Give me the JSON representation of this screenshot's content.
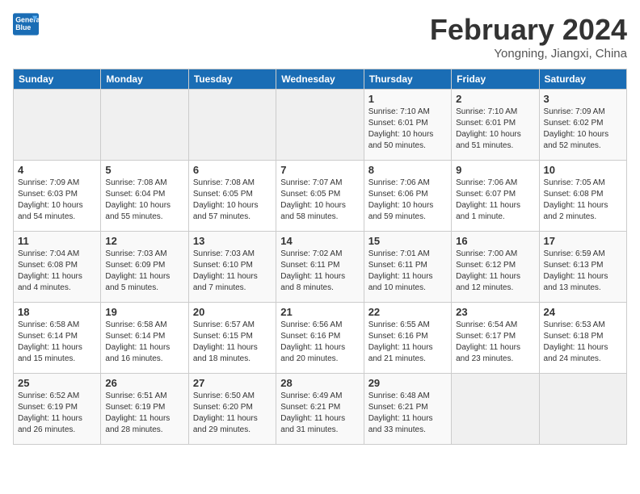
{
  "header": {
    "logo_line1": "General",
    "logo_line2": "Blue",
    "month": "February 2024",
    "location": "Yongning, Jiangxi, China"
  },
  "weekdays": [
    "Sunday",
    "Monday",
    "Tuesday",
    "Wednesday",
    "Thursday",
    "Friday",
    "Saturday"
  ],
  "weeks": [
    [
      {
        "day": "",
        "info": ""
      },
      {
        "day": "",
        "info": ""
      },
      {
        "day": "",
        "info": ""
      },
      {
        "day": "",
        "info": ""
      },
      {
        "day": "1",
        "info": "Sunrise: 7:10 AM\nSunset: 6:01 PM\nDaylight: 10 hours\nand 50 minutes."
      },
      {
        "day": "2",
        "info": "Sunrise: 7:10 AM\nSunset: 6:01 PM\nDaylight: 10 hours\nand 51 minutes."
      },
      {
        "day": "3",
        "info": "Sunrise: 7:09 AM\nSunset: 6:02 PM\nDaylight: 10 hours\nand 52 minutes."
      }
    ],
    [
      {
        "day": "4",
        "info": "Sunrise: 7:09 AM\nSunset: 6:03 PM\nDaylight: 10 hours\nand 54 minutes."
      },
      {
        "day": "5",
        "info": "Sunrise: 7:08 AM\nSunset: 6:04 PM\nDaylight: 10 hours\nand 55 minutes."
      },
      {
        "day": "6",
        "info": "Sunrise: 7:08 AM\nSunset: 6:05 PM\nDaylight: 10 hours\nand 57 minutes."
      },
      {
        "day": "7",
        "info": "Sunrise: 7:07 AM\nSunset: 6:05 PM\nDaylight: 10 hours\nand 58 minutes."
      },
      {
        "day": "8",
        "info": "Sunrise: 7:06 AM\nSunset: 6:06 PM\nDaylight: 10 hours\nand 59 minutes."
      },
      {
        "day": "9",
        "info": "Sunrise: 7:06 AM\nSunset: 6:07 PM\nDaylight: 11 hours\nand 1 minute."
      },
      {
        "day": "10",
        "info": "Sunrise: 7:05 AM\nSunset: 6:08 PM\nDaylight: 11 hours\nand 2 minutes."
      }
    ],
    [
      {
        "day": "11",
        "info": "Sunrise: 7:04 AM\nSunset: 6:08 PM\nDaylight: 11 hours\nand 4 minutes."
      },
      {
        "day": "12",
        "info": "Sunrise: 7:03 AM\nSunset: 6:09 PM\nDaylight: 11 hours\nand 5 minutes."
      },
      {
        "day": "13",
        "info": "Sunrise: 7:03 AM\nSunset: 6:10 PM\nDaylight: 11 hours\nand 7 minutes."
      },
      {
        "day": "14",
        "info": "Sunrise: 7:02 AM\nSunset: 6:11 PM\nDaylight: 11 hours\nand 8 minutes."
      },
      {
        "day": "15",
        "info": "Sunrise: 7:01 AM\nSunset: 6:11 PM\nDaylight: 11 hours\nand 10 minutes."
      },
      {
        "day": "16",
        "info": "Sunrise: 7:00 AM\nSunset: 6:12 PM\nDaylight: 11 hours\nand 12 minutes."
      },
      {
        "day": "17",
        "info": "Sunrise: 6:59 AM\nSunset: 6:13 PM\nDaylight: 11 hours\nand 13 minutes."
      }
    ],
    [
      {
        "day": "18",
        "info": "Sunrise: 6:58 AM\nSunset: 6:14 PM\nDaylight: 11 hours\nand 15 minutes."
      },
      {
        "day": "19",
        "info": "Sunrise: 6:58 AM\nSunset: 6:14 PM\nDaylight: 11 hours\nand 16 minutes."
      },
      {
        "day": "20",
        "info": "Sunrise: 6:57 AM\nSunset: 6:15 PM\nDaylight: 11 hours\nand 18 minutes."
      },
      {
        "day": "21",
        "info": "Sunrise: 6:56 AM\nSunset: 6:16 PM\nDaylight: 11 hours\nand 20 minutes."
      },
      {
        "day": "22",
        "info": "Sunrise: 6:55 AM\nSunset: 6:16 PM\nDaylight: 11 hours\nand 21 minutes."
      },
      {
        "day": "23",
        "info": "Sunrise: 6:54 AM\nSunset: 6:17 PM\nDaylight: 11 hours\nand 23 minutes."
      },
      {
        "day": "24",
        "info": "Sunrise: 6:53 AM\nSunset: 6:18 PM\nDaylight: 11 hours\nand 24 minutes."
      }
    ],
    [
      {
        "day": "25",
        "info": "Sunrise: 6:52 AM\nSunset: 6:19 PM\nDaylight: 11 hours\nand 26 minutes."
      },
      {
        "day": "26",
        "info": "Sunrise: 6:51 AM\nSunset: 6:19 PM\nDaylight: 11 hours\nand 28 minutes."
      },
      {
        "day": "27",
        "info": "Sunrise: 6:50 AM\nSunset: 6:20 PM\nDaylight: 11 hours\nand 29 minutes."
      },
      {
        "day": "28",
        "info": "Sunrise: 6:49 AM\nSunset: 6:21 PM\nDaylight: 11 hours\nand 31 minutes."
      },
      {
        "day": "29",
        "info": "Sunrise: 6:48 AM\nSunset: 6:21 PM\nDaylight: 11 hours\nand 33 minutes."
      },
      {
        "day": "",
        "info": ""
      },
      {
        "day": "",
        "info": ""
      }
    ]
  ]
}
